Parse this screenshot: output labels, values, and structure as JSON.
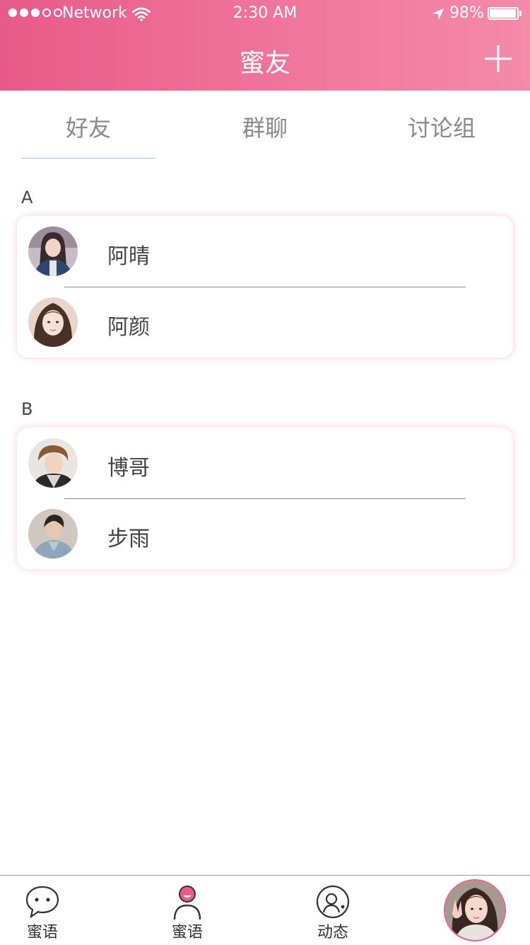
{
  "status_bar": {
    "carrier": "Network",
    "time": "2:30 AM",
    "battery": "98%",
    "battery_level": 0.98,
    "signal_bars": 3,
    "signal_total": 5
  },
  "nav": {
    "title": "蜜友",
    "add_icon": "plus-icon"
  },
  "tabs": [
    {
      "label": "好友",
      "active": true
    },
    {
      "label": "群聊",
      "active": false
    },
    {
      "label": "讨论组",
      "active": false
    }
  ],
  "sections": [
    {
      "letter": "A",
      "contacts": [
        {
          "name": "阿晴"
        },
        {
          "name": "阿颜"
        }
      ]
    },
    {
      "letter": "B",
      "contacts": [
        {
          "name": "博哥"
        },
        {
          "name": "步雨"
        }
      ]
    }
  ],
  "tabbar": {
    "items": [
      {
        "label": "蜜语",
        "icon": "chat-bubble-icon"
      },
      {
        "label": "蜜语",
        "icon": "person-icon"
      },
      {
        "label": "动态",
        "icon": "moments-icon"
      }
    ],
    "profile_icon": "profile-avatar"
  },
  "colors": {
    "header_gradient_start": "#e85a89",
    "header_gradient_end": "#f58aa9",
    "accent": "#e8608f",
    "tab_indicator": "#9bc7f0"
  }
}
